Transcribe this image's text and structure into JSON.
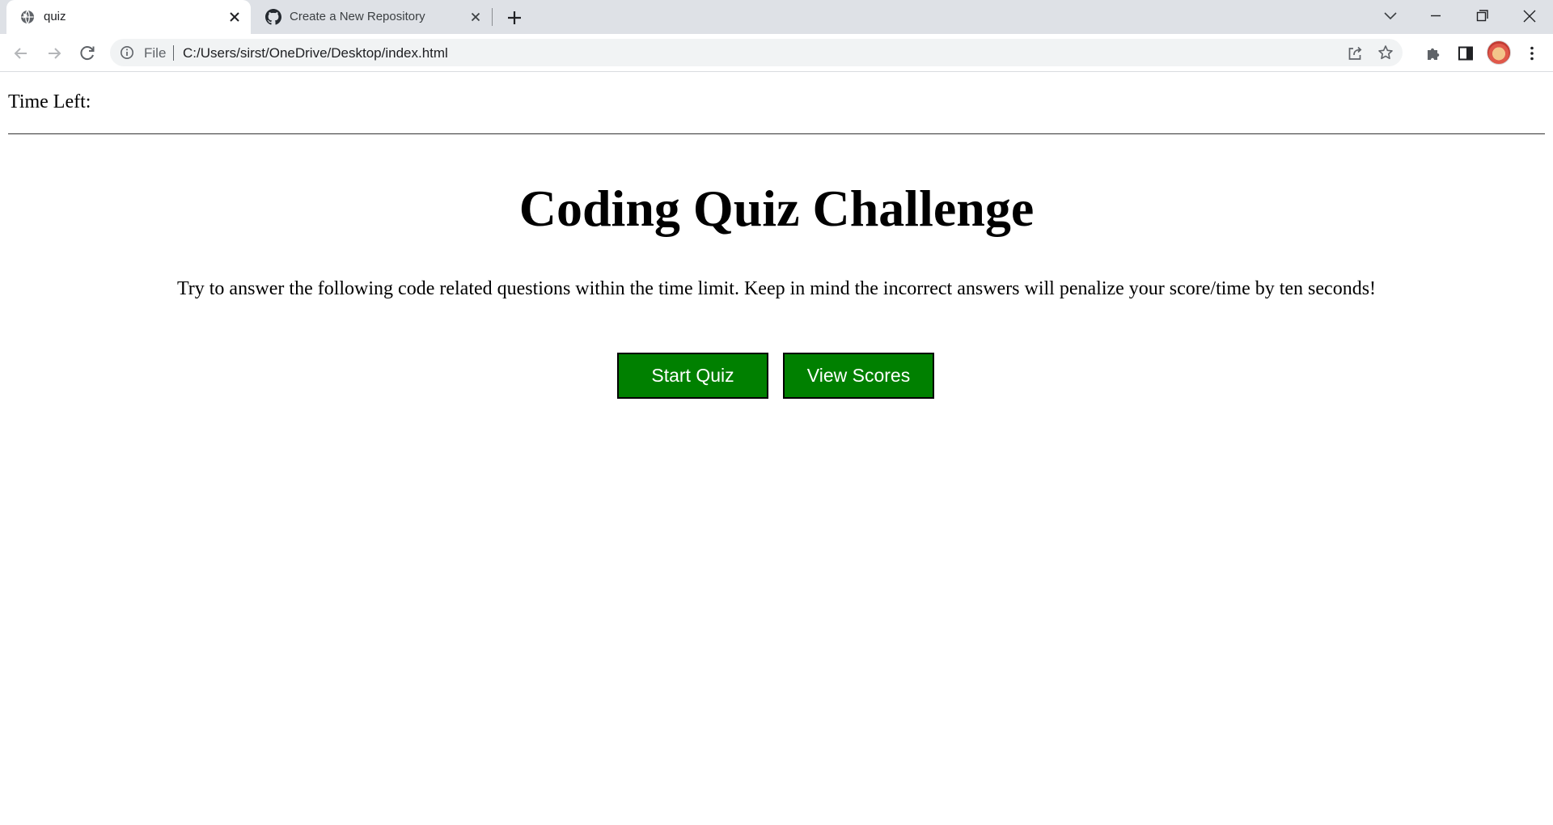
{
  "browser": {
    "tabs": [
      {
        "title": "quiz",
        "icon": "globe-icon",
        "active": true
      },
      {
        "title": "Create a New Repository",
        "icon": "github-icon",
        "active": false
      }
    ],
    "address_bar": {
      "scheme_label": "File",
      "url": "C:/Users/sirst/OneDrive/Desktop/index.html"
    }
  },
  "page": {
    "timer_label": "Time Left:",
    "title": "Coding Quiz Challenge",
    "intro": "Try to answer the following code related questions within the time limit. Keep in mind the incorrect answers will penalize your score/time by ten seconds!",
    "buttons": {
      "start": "Start Quiz",
      "scores": "View Scores"
    }
  },
  "colors": {
    "button_bg": "#008000",
    "button_text": "#ffffff",
    "tabstrip_bg": "#dee1e6",
    "omnibox_bg": "#f1f3f4"
  }
}
